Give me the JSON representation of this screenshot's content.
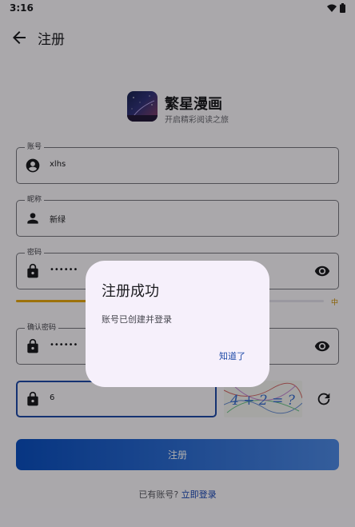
{
  "status": {
    "time": "3:16"
  },
  "header": {
    "title": "注册"
  },
  "brand": {
    "name": "繁星漫画",
    "slogan": "开启精彩阅读之旅"
  },
  "form": {
    "account": {
      "label": "账号",
      "value": "xlhs"
    },
    "nickname": {
      "label": "昵称",
      "value": "新绿"
    },
    "password": {
      "label": "密码",
      "value": "••••••"
    },
    "password_strength": {
      "label": "中",
      "level": 0.55,
      "color": "#e7a913"
    },
    "confirm_password": {
      "label": "确认密码",
      "value": "••••••"
    },
    "captcha": {
      "value": "6",
      "image_text": "4 + 2 = ?"
    },
    "submit_label": "注册"
  },
  "footer": {
    "prompt": "已有账号?",
    "link": "立即登录"
  },
  "dialog": {
    "title": "注册成功",
    "message": "账号已创建并登录",
    "confirm_label": "知道了"
  },
  "colors": {
    "primary": "#1f4aa8",
    "warning": "#e7a913",
    "background": "#fbf8fd"
  }
}
